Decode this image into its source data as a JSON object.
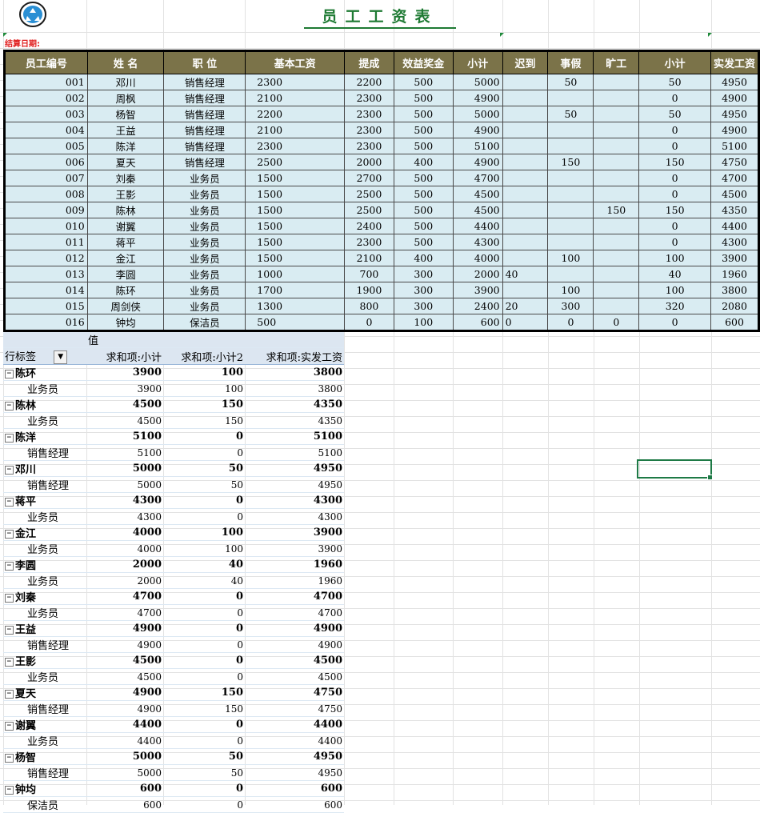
{
  "sheet": {
    "title": "员工工资表",
    "date_label": "结算日期:",
    "headers": [
      "员工编号",
      "姓 名",
      "职 位",
      "基本工资",
      "提成",
      "效益奖金",
      "小计",
      "迟到",
      "事假",
      "旷工",
      "小计",
      "实发工资"
    ],
    "rows": [
      [
        "001",
        "邓川",
        "销售经理",
        "2300",
        "2200",
        "500",
        "5000",
        "",
        "50",
        "",
        "50",
        "4950"
      ],
      [
        "002",
        "周枫",
        "销售经理",
        "2100",
        "2300",
        "500",
        "4900",
        "",
        "",
        "",
        "0",
        "4900"
      ],
      [
        "003",
        "杨智",
        "销售经理",
        "2200",
        "2300",
        "500",
        "5000",
        "",
        "50",
        "",
        "50",
        "4950"
      ],
      [
        "004",
        "王益",
        "销售经理",
        "2100",
        "2300",
        "500",
        "4900",
        "",
        "",
        "",
        "0",
        "4900"
      ],
      [
        "005",
        "陈洋",
        "销售经理",
        "2300",
        "2300",
        "500",
        "5100",
        "",
        "",
        "",
        "0",
        "5100"
      ],
      [
        "006",
        "夏天",
        "销售经理",
        "2500",
        "2000",
        "400",
        "4900",
        "",
        "150",
        "",
        "150",
        "4750"
      ],
      [
        "007",
        "刘秦",
        "业务员",
        "1500",
        "2700",
        "500",
        "4700",
        "",
        "",
        "",
        "0",
        "4700"
      ],
      [
        "008",
        "王影",
        "业务员",
        "1500",
        "2500",
        "500",
        "4500",
        "",
        "",
        "",
        "0",
        "4500"
      ],
      [
        "009",
        "陈林",
        "业务员",
        "1500",
        "2500",
        "500",
        "4500",
        "",
        "",
        "150",
        "150",
        "4350"
      ],
      [
        "010",
        "谢翼",
        "业务员",
        "1500",
        "2400",
        "500",
        "4400",
        "",
        "",
        "",
        "0",
        "4400"
      ],
      [
        "011",
        "蒋平",
        "业务员",
        "1500",
        "2300",
        "500",
        "4300",
        "",
        "",
        "",
        "0",
        "4300"
      ],
      [
        "012",
        "金江",
        "业务员",
        "1500",
        "2100",
        "400",
        "4000",
        "",
        "100",
        "",
        "100",
        "3900"
      ],
      [
        "013",
        "李圆",
        "业务员",
        "1000",
        "700",
        "300",
        "2000",
        "40",
        "",
        "",
        "40",
        "1960"
      ],
      [
        "014",
        "陈环",
        "业务员",
        "1700",
        "1900",
        "300",
        "3900",
        "",
        "100",
        "",
        "100",
        "3800"
      ],
      [
        "015",
        "周剑侠",
        "业务员",
        "1300",
        "800",
        "300",
        "2400",
        "20",
        "300",
        "",
        "320",
        "2080"
      ],
      [
        "016",
        "钟均",
        "保洁员",
        "500",
        "0",
        "100",
        "600",
        "0",
        "0",
        "0",
        "0",
        "600"
      ]
    ]
  },
  "pivot": {
    "values_label": "值",
    "row_label": "行标签",
    "filter_icon": "▼",
    "columns": [
      "求和项:小计",
      "求和项:小计2",
      "求和项:实发工资"
    ],
    "groups": [
      {
        "name": "陈环",
        "values": [
          "3900",
          "100",
          "3800"
        ],
        "sub": "业务员",
        "sub_values": [
          "3900",
          "100",
          "3800"
        ]
      },
      {
        "name": "陈林",
        "values": [
          "4500",
          "150",
          "4350"
        ],
        "sub": "业务员",
        "sub_values": [
          "4500",
          "150",
          "4350"
        ]
      },
      {
        "name": "陈洋",
        "values": [
          "5100",
          "0",
          "5100"
        ],
        "sub": "销售经理",
        "sub_values": [
          "5100",
          "0",
          "5100"
        ]
      },
      {
        "name": "邓川",
        "values": [
          "5000",
          "50",
          "4950"
        ],
        "sub": "销售经理",
        "sub_values": [
          "5000",
          "50",
          "4950"
        ]
      },
      {
        "name": "蒋平",
        "values": [
          "4300",
          "0",
          "4300"
        ],
        "sub": "业务员",
        "sub_values": [
          "4300",
          "0",
          "4300"
        ]
      },
      {
        "name": "金江",
        "values": [
          "4000",
          "100",
          "3900"
        ],
        "sub": "业务员",
        "sub_values": [
          "4000",
          "100",
          "3900"
        ]
      },
      {
        "name": "李圆",
        "values": [
          "2000",
          "40",
          "1960"
        ],
        "sub": "业务员",
        "sub_values": [
          "2000",
          "40",
          "1960"
        ]
      },
      {
        "name": "刘秦",
        "values": [
          "4700",
          "0",
          "4700"
        ],
        "sub": "业务员",
        "sub_values": [
          "4700",
          "0",
          "4700"
        ]
      },
      {
        "name": "王益",
        "values": [
          "4900",
          "0",
          "4900"
        ],
        "sub": "销售经理",
        "sub_values": [
          "4900",
          "0",
          "4900"
        ]
      },
      {
        "name": "王影",
        "values": [
          "4500",
          "0",
          "4500"
        ],
        "sub": "业务员",
        "sub_values": [
          "4500",
          "0",
          "4500"
        ]
      },
      {
        "name": "夏天",
        "values": [
          "4900",
          "150",
          "4750"
        ],
        "sub": "销售经理",
        "sub_values": [
          "4900",
          "150",
          "4750"
        ]
      },
      {
        "name": "谢翼",
        "values": [
          "4400",
          "0",
          "4400"
        ],
        "sub": "业务员",
        "sub_values": [
          "4400",
          "0",
          "4400"
        ]
      },
      {
        "name": "杨智",
        "values": [
          "5000",
          "50",
          "4950"
        ],
        "sub": "销售经理",
        "sub_values": [
          "5000",
          "50",
          "4950"
        ]
      },
      {
        "name": "钟均",
        "values": [
          "600",
          "0",
          "600"
        ],
        "sub": "保洁员",
        "sub_values": [
          "600",
          "0",
          "600"
        ]
      }
    ]
  }
}
